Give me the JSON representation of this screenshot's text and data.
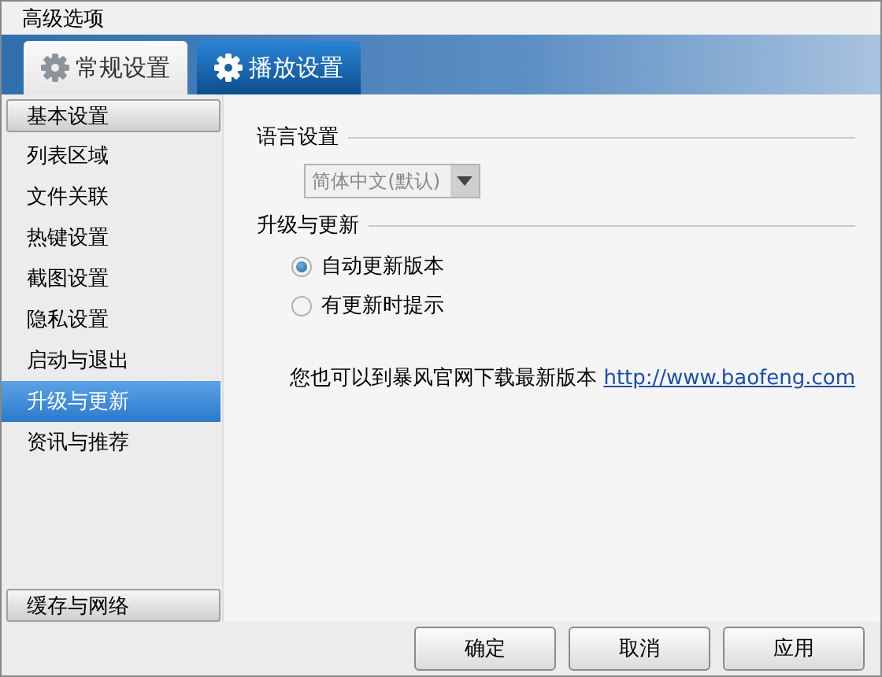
{
  "window": {
    "title": "高级选项"
  },
  "tabs": [
    {
      "label": "常规设置",
      "selected": true
    },
    {
      "label": "播放设置",
      "selected": false
    }
  ],
  "sidebar": {
    "sections": [
      {
        "label": "基本设置",
        "items": [
          {
            "label": "列表区域",
            "selected": false
          },
          {
            "label": "文件关联",
            "selected": false
          },
          {
            "label": "热键设置",
            "selected": false
          },
          {
            "label": "截图设置",
            "selected": false
          },
          {
            "label": "隐私设置",
            "selected": false
          },
          {
            "label": "启动与退出",
            "selected": false
          },
          {
            "label": "升级与更新",
            "selected": true
          },
          {
            "label": "资讯与推荐",
            "selected": false
          }
        ]
      },
      {
        "label": "缓存与网络"
      }
    ]
  },
  "language": {
    "heading": "语言设置",
    "dropdown": {
      "value": "简体中文(默认)",
      "disabled": true
    }
  },
  "update": {
    "heading": "升级与更新",
    "options": [
      {
        "label": "自动更新版本",
        "selected": true
      },
      {
        "label": "有更新时提示",
        "selected": false
      }
    ],
    "note": "您也可以到暴风官网下载最新版本",
    "link": "http://www.baofeng.com"
  },
  "buttons": [
    "确定",
    "取消",
    "应用"
  ]
}
